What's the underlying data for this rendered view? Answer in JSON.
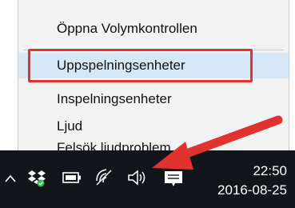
{
  "context_menu": {
    "items": [
      {
        "label": "Öppna Volymkontrollen"
      },
      {
        "label": "Uppspelningsenheter"
      },
      {
        "label": "Inspelningsenheter"
      },
      {
        "label": "Ljud"
      },
      {
        "label": "Felsök ljudproblem"
      }
    ],
    "highlighted_index": 1
  },
  "annotation": {
    "box_color": "#e0322f",
    "arrow_color": "#e0322f"
  },
  "taskbar": {
    "icons": [
      "chevron-up-icon",
      "dropbox-icon",
      "battery-icon",
      "wifi-icon",
      "speaker-icon",
      "action-center-icon"
    ],
    "time": "22:50",
    "date": "2016-08-25"
  }
}
